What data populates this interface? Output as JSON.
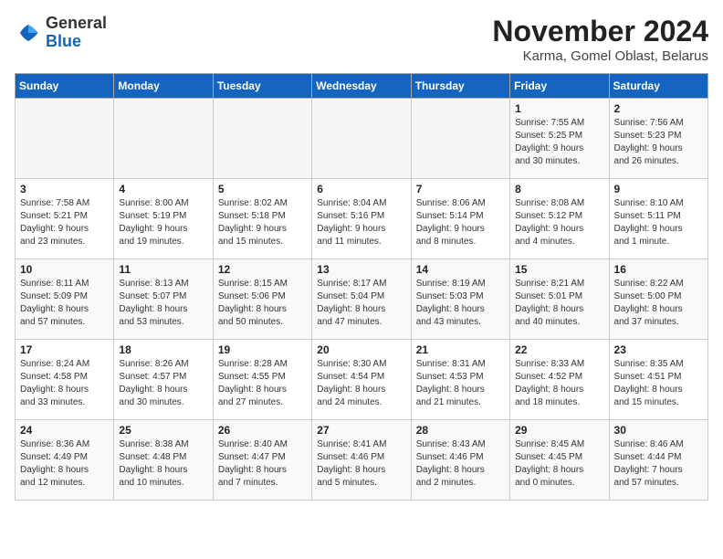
{
  "logo": {
    "general": "General",
    "blue": "Blue"
  },
  "title": "November 2024",
  "subtitle": "Karma, Gomel Oblast, Belarus",
  "days_of_week": [
    "Sunday",
    "Monday",
    "Tuesday",
    "Wednesday",
    "Thursday",
    "Friday",
    "Saturday"
  ],
  "weeks": [
    [
      {
        "day": "",
        "info": ""
      },
      {
        "day": "",
        "info": ""
      },
      {
        "day": "",
        "info": ""
      },
      {
        "day": "",
        "info": ""
      },
      {
        "day": "",
        "info": ""
      },
      {
        "day": "1",
        "info": "Sunrise: 7:55 AM\nSunset: 5:25 PM\nDaylight: 9 hours\nand 30 minutes."
      },
      {
        "day": "2",
        "info": "Sunrise: 7:56 AM\nSunset: 5:23 PM\nDaylight: 9 hours\nand 26 minutes."
      }
    ],
    [
      {
        "day": "3",
        "info": "Sunrise: 7:58 AM\nSunset: 5:21 PM\nDaylight: 9 hours\nand 23 minutes."
      },
      {
        "day": "4",
        "info": "Sunrise: 8:00 AM\nSunset: 5:19 PM\nDaylight: 9 hours\nand 19 minutes."
      },
      {
        "day": "5",
        "info": "Sunrise: 8:02 AM\nSunset: 5:18 PM\nDaylight: 9 hours\nand 15 minutes."
      },
      {
        "day": "6",
        "info": "Sunrise: 8:04 AM\nSunset: 5:16 PM\nDaylight: 9 hours\nand 11 minutes."
      },
      {
        "day": "7",
        "info": "Sunrise: 8:06 AM\nSunset: 5:14 PM\nDaylight: 9 hours\nand 8 minutes."
      },
      {
        "day": "8",
        "info": "Sunrise: 8:08 AM\nSunset: 5:12 PM\nDaylight: 9 hours\nand 4 minutes."
      },
      {
        "day": "9",
        "info": "Sunrise: 8:10 AM\nSunset: 5:11 PM\nDaylight: 9 hours\nand 1 minute."
      }
    ],
    [
      {
        "day": "10",
        "info": "Sunrise: 8:11 AM\nSunset: 5:09 PM\nDaylight: 8 hours\nand 57 minutes."
      },
      {
        "day": "11",
        "info": "Sunrise: 8:13 AM\nSunset: 5:07 PM\nDaylight: 8 hours\nand 53 minutes."
      },
      {
        "day": "12",
        "info": "Sunrise: 8:15 AM\nSunset: 5:06 PM\nDaylight: 8 hours\nand 50 minutes."
      },
      {
        "day": "13",
        "info": "Sunrise: 8:17 AM\nSunset: 5:04 PM\nDaylight: 8 hours\nand 47 minutes."
      },
      {
        "day": "14",
        "info": "Sunrise: 8:19 AM\nSunset: 5:03 PM\nDaylight: 8 hours\nand 43 minutes."
      },
      {
        "day": "15",
        "info": "Sunrise: 8:21 AM\nSunset: 5:01 PM\nDaylight: 8 hours\nand 40 minutes."
      },
      {
        "day": "16",
        "info": "Sunrise: 8:22 AM\nSunset: 5:00 PM\nDaylight: 8 hours\nand 37 minutes."
      }
    ],
    [
      {
        "day": "17",
        "info": "Sunrise: 8:24 AM\nSunset: 4:58 PM\nDaylight: 8 hours\nand 33 minutes."
      },
      {
        "day": "18",
        "info": "Sunrise: 8:26 AM\nSunset: 4:57 PM\nDaylight: 8 hours\nand 30 minutes."
      },
      {
        "day": "19",
        "info": "Sunrise: 8:28 AM\nSunset: 4:55 PM\nDaylight: 8 hours\nand 27 minutes."
      },
      {
        "day": "20",
        "info": "Sunrise: 8:30 AM\nSunset: 4:54 PM\nDaylight: 8 hours\nand 24 minutes."
      },
      {
        "day": "21",
        "info": "Sunrise: 8:31 AM\nSunset: 4:53 PM\nDaylight: 8 hours\nand 21 minutes."
      },
      {
        "day": "22",
        "info": "Sunrise: 8:33 AM\nSunset: 4:52 PM\nDaylight: 8 hours\nand 18 minutes."
      },
      {
        "day": "23",
        "info": "Sunrise: 8:35 AM\nSunset: 4:51 PM\nDaylight: 8 hours\nand 15 minutes."
      }
    ],
    [
      {
        "day": "24",
        "info": "Sunrise: 8:36 AM\nSunset: 4:49 PM\nDaylight: 8 hours\nand 12 minutes."
      },
      {
        "day": "25",
        "info": "Sunrise: 8:38 AM\nSunset: 4:48 PM\nDaylight: 8 hours\nand 10 minutes."
      },
      {
        "day": "26",
        "info": "Sunrise: 8:40 AM\nSunset: 4:47 PM\nDaylight: 8 hours\nand 7 minutes."
      },
      {
        "day": "27",
        "info": "Sunrise: 8:41 AM\nSunset: 4:46 PM\nDaylight: 8 hours\nand 5 minutes."
      },
      {
        "day": "28",
        "info": "Sunrise: 8:43 AM\nSunset: 4:46 PM\nDaylight: 8 hours\nand 2 minutes."
      },
      {
        "day": "29",
        "info": "Sunrise: 8:45 AM\nSunset: 4:45 PM\nDaylight: 8 hours\nand 0 minutes."
      },
      {
        "day": "30",
        "info": "Sunrise: 8:46 AM\nSunset: 4:44 PM\nDaylight: 7 hours\nand 57 minutes."
      }
    ]
  ]
}
